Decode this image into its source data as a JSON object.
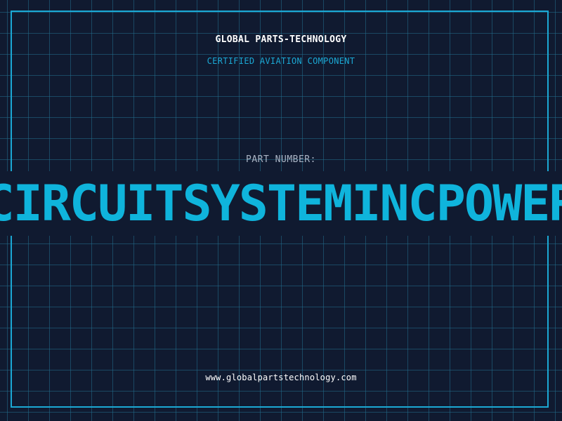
{
  "header": {
    "company": "GLOBAL PARTS-TECHNOLOGY",
    "subtitle": "CERTIFIED AVIATION COMPONENT"
  },
  "part": {
    "label": "PART NUMBER:",
    "number": "CIRCUITSYSTEMINCPOWER"
  },
  "footer": {
    "url": "www.globalpartstechnology.com"
  },
  "colors": {
    "background": "#101a30",
    "accent": "#0fb4dc",
    "grid": "#226e8c",
    "label": "#aab4c4",
    "text": "#ffffff"
  }
}
